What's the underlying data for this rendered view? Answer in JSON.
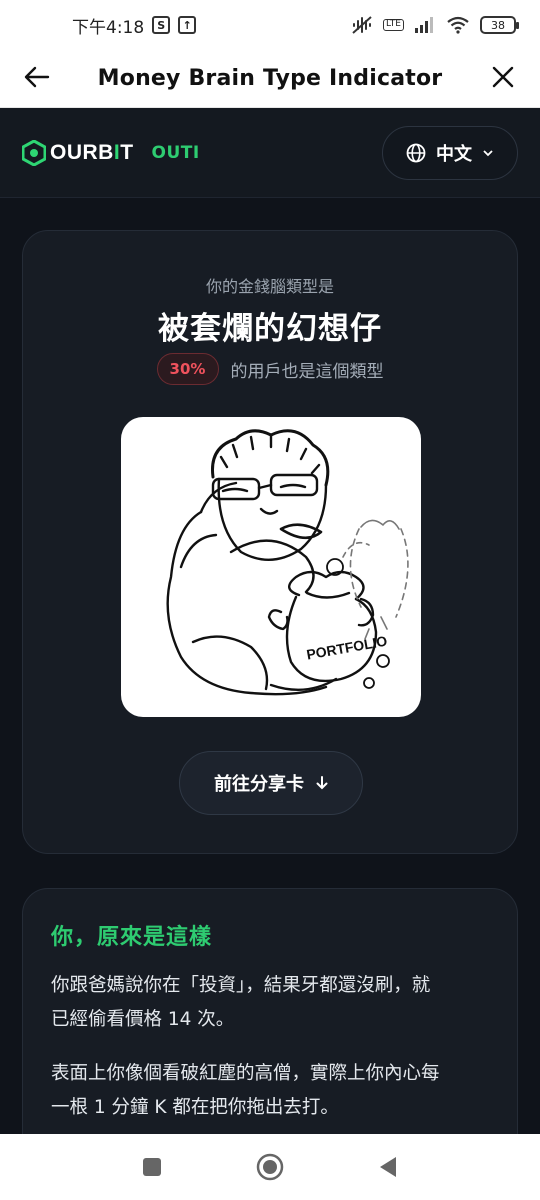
{
  "status_bar": {
    "time": "下午4:18",
    "battery": "38",
    "network": "LTE"
  },
  "app_bar": {
    "title": "Money Brain Type Indicator",
    "back_icon": "arrow-left-icon",
    "close_icon": "close-icon"
  },
  "brand": {
    "logo_main": "OURB",
    "logo_accent": "I",
    "logo_tail": "T",
    "product": "OUTI",
    "language": "中文",
    "accent_color": "#2ecc71"
  },
  "result": {
    "subtitle": "你的金錢腦類型是",
    "type_name": "被套爛的幻想仔",
    "percent_label": "30%",
    "percent_value": 30,
    "percent_text": "的用戶也是這個類型",
    "illustration_label": "PORTFOLIO",
    "share_button": "前往分享卡"
  },
  "description": {
    "title": "你，原來是這樣",
    "p1_line1": "你跟爸媽說你在「投資」，結果牙都還沒刷，就",
    "p1_line2": "已經偷看價格 14 次。",
    "p2_line1": "表面上你像個看破紅塵的高僧，實際上你內心每",
    "p2_line2": "一根 1 分鐘 K 都在把你拖出去打。"
  }
}
